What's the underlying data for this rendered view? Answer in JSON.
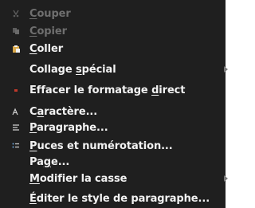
{
  "menu": {
    "items": [
      {
        "pre": "",
        "key": "C",
        "post": "ouper",
        "disabled": true,
        "icon": "scissors-icon"
      },
      {
        "pre": "",
        "key": "C",
        "post": "opier",
        "disabled": true,
        "icon": "copy-icon"
      },
      {
        "pre": "",
        "key": "C",
        "post": "oller",
        "disabled": false,
        "icon": "paste-icon"
      },
      {
        "pre": "Collage ",
        "key": "s",
        "post": "pécial",
        "disabled": false,
        "icon": "",
        "submenu": true
      },
      {
        "pre": "Effacer le formatage ",
        "key": "d",
        "post": "irect",
        "disabled": false,
        "icon": "clear-formatting-icon"
      },
      {
        "pre": "C",
        "key": "a",
        "post": "ractère...",
        "disabled": false,
        "icon": "character-icon"
      },
      {
        "pre": "",
        "key": "P",
        "post": "aragraphe...",
        "disabled": false,
        "icon": "paragraph-icon"
      },
      {
        "pre": "",
        "key": "P",
        "post": "uces et numérotation...",
        "disabled": false,
        "icon": "bullets-numbering-icon"
      },
      {
        "pre": "Pa",
        "key": "g",
        "post": "e...",
        "disabled": false,
        "icon": ""
      },
      {
        "pre": "",
        "key": "M",
        "post": "odifier la casse",
        "disabled": false,
        "icon": "",
        "submenu": true
      },
      {
        "pre": "",
        "key": "É",
        "post": "diter le style de paragraphe...",
        "disabled": false,
        "icon": ""
      }
    ]
  },
  "colors": {
    "background": "#1f1f1f",
    "text": "#f2f2f2",
    "disabled_text": "#6f6f6f",
    "paste_icon": "#d9a84a",
    "clear_formatting_icon": "#c0392b"
  }
}
